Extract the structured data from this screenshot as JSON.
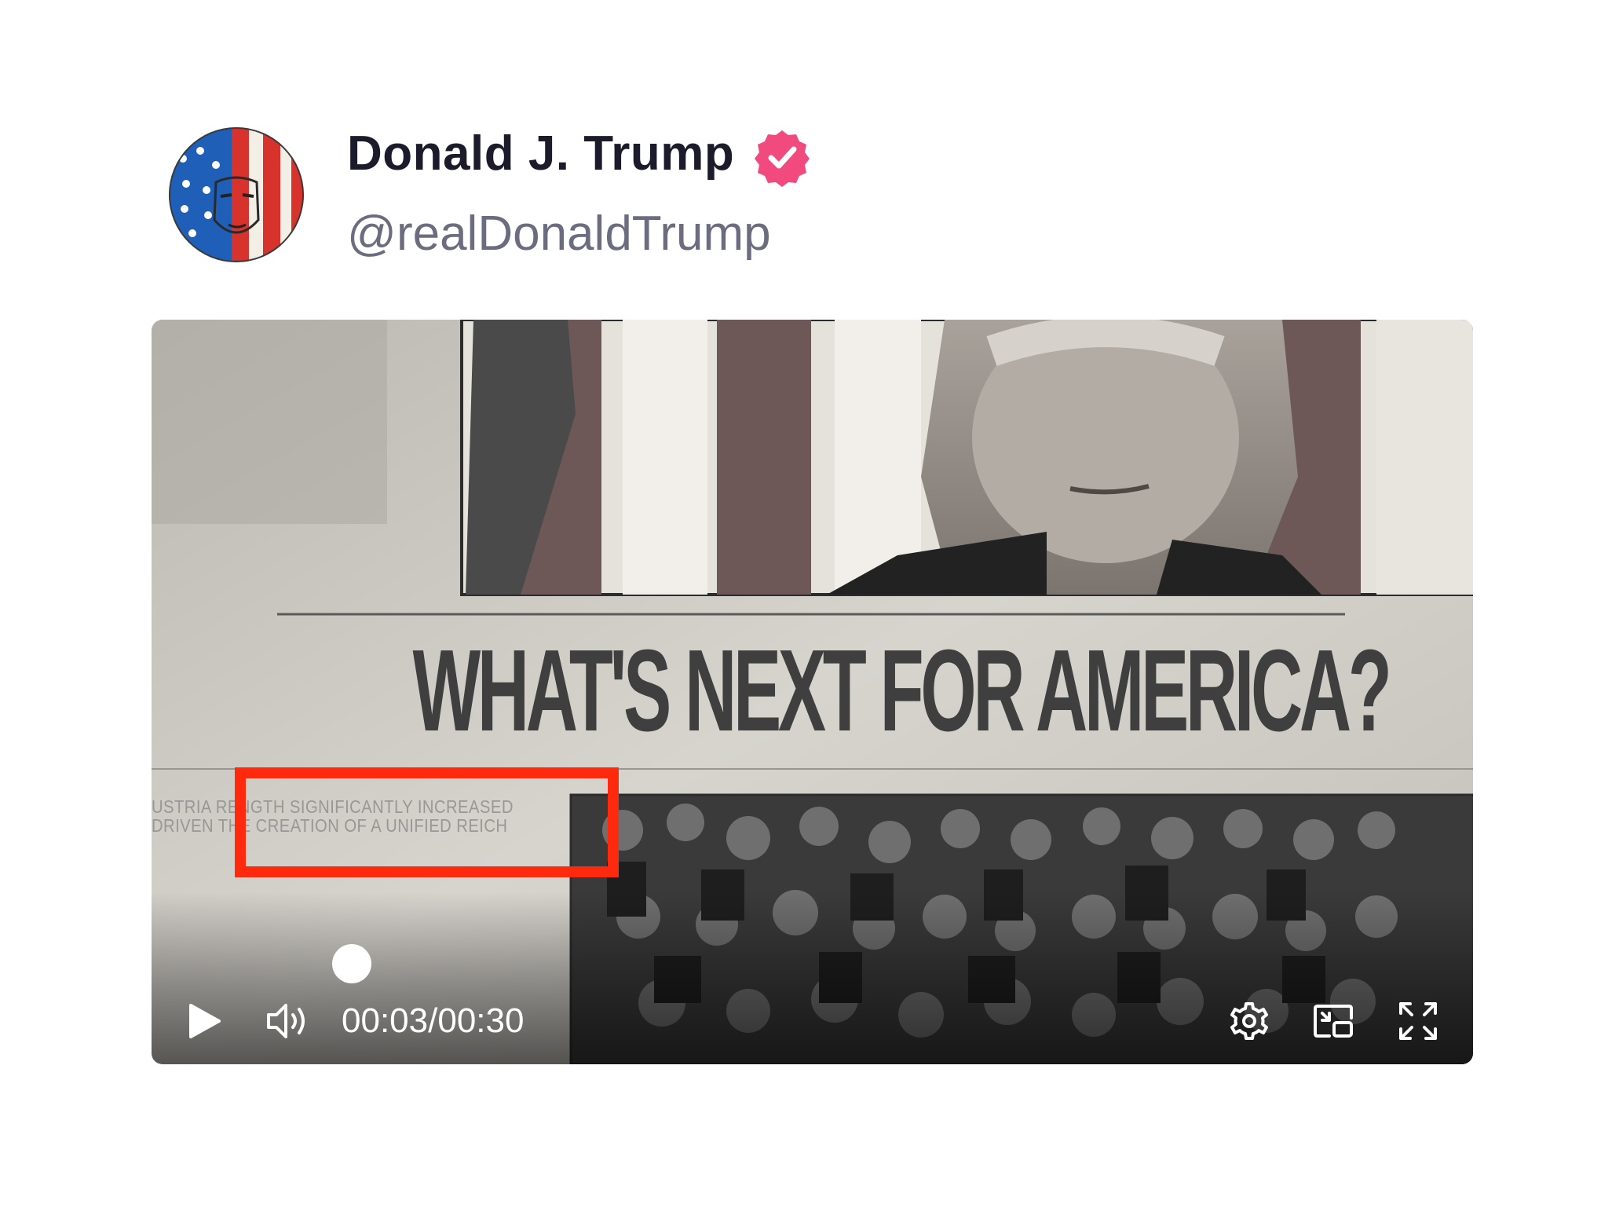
{
  "post": {
    "display_name": "Donald J. Trump",
    "verified_icon": "verified-badge-icon",
    "handle": "@realDonaldTrump"
  },
  "video": {
    "headline": "WHAT'S NEXT FOR AMERICA?",
    "snippet_line1": "USTRIA  RENGTH SIGNIFICANTLY INCREASED",
    "snippet_line2": "DRIVEN  THE CREATION OF A UNIFIED REICH",
    "player": {
      "current_time": "00:03",
      "separator": "/",
      "duration": "00:30",
      "progress": 0.1,
      "icons": [
        "play-icon",
        "volume-icon",
        "settings-icon",
        "picture-in-picture-icon",
        "fullscreen-icon"
      ]
    },
    "highlight_color": "#ff2a0e"
  },
  "colors": {
    "verified_badge": "#f04a7e",
    "name_text": "#1b1b2b",
    "handle_text": "#6c6c80"
  }
}
